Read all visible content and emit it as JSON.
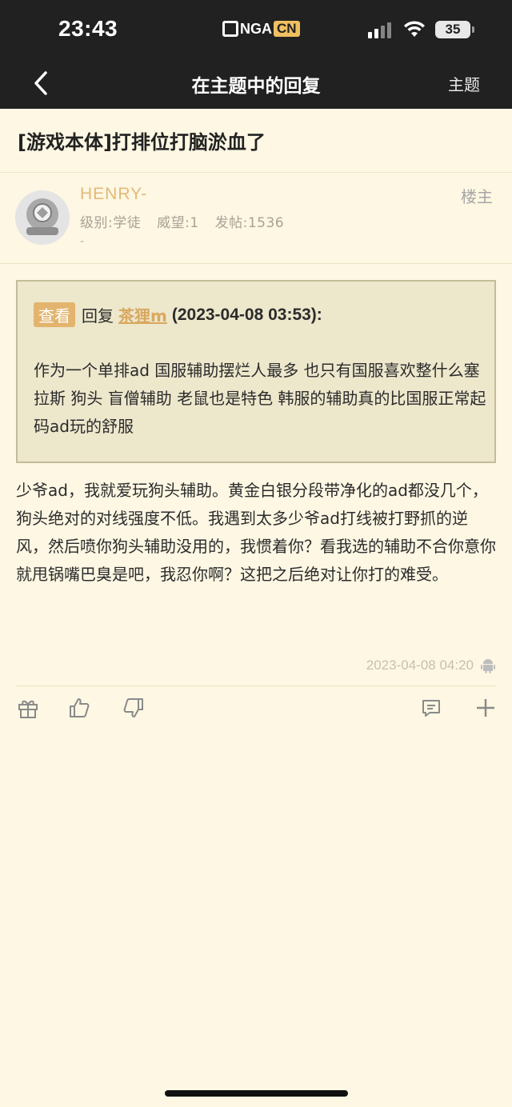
{
  "status_bar": {
    "time": "23:43",
    "logo_text": "NGA",
    "logo_cn": "CN",
    "battery": "35"
  },
  "nav": {
    "title": "在主题中的回复",
    "right_label": "主题"
  },
  "thread": {
    "title": "[游戏本体]打排位打脑淤血了"
  },
  "author": {
    "name": "HENRY-",
    "level": "级别:学徒",
    "reputation": "威望:1",
    "posts": "发帖:1536",
    "signature": "-",
    "floor": "楼主"
  },
  "quote": {
    "tag": "查看",
    "reply_label": "回复",
    "user": "茶狸m",
    "time": "(2023-04-08 03:53):",
    "text": "作为一个单排ad 国服辅助摆烂人最多 也只有国服喜欢整什么塞拉斯 狗头 盲僧辅助 老鼠也是特色 韩服的辅助真的比国服正常起码ad玩的舒服"
  },
  "post": {
    "body": "少爷ad，我就爱玩狗头辅助。黄金白银分段带净化的ad都没几个，狗头绝对的对线强度不低。我遇到太多少爷ad打线被打野抓的逆风，然后喷你狗头辅助没用的，我惯着你？看我选的辅助不合你意你就甩锅嘴巴臭是吧，我忍你啊？这把之后绝对让你打的难受。",
    "time": "2023-04-08 04:20",
    "client_icon": "android-icon"
  },
  "actions": [
    "gift-icon",
    "thumbs-up-icon",
    "thumbs-down-icon",
    "comment-icon",
    "plus-icon"
  ],
  "colors": {
    "header_bg": "#212121",
    "page_bg": "#fdf7e3",
    "accent": "#e2b46d",
    "quote_bg": "#ede7cc"
  }
}
